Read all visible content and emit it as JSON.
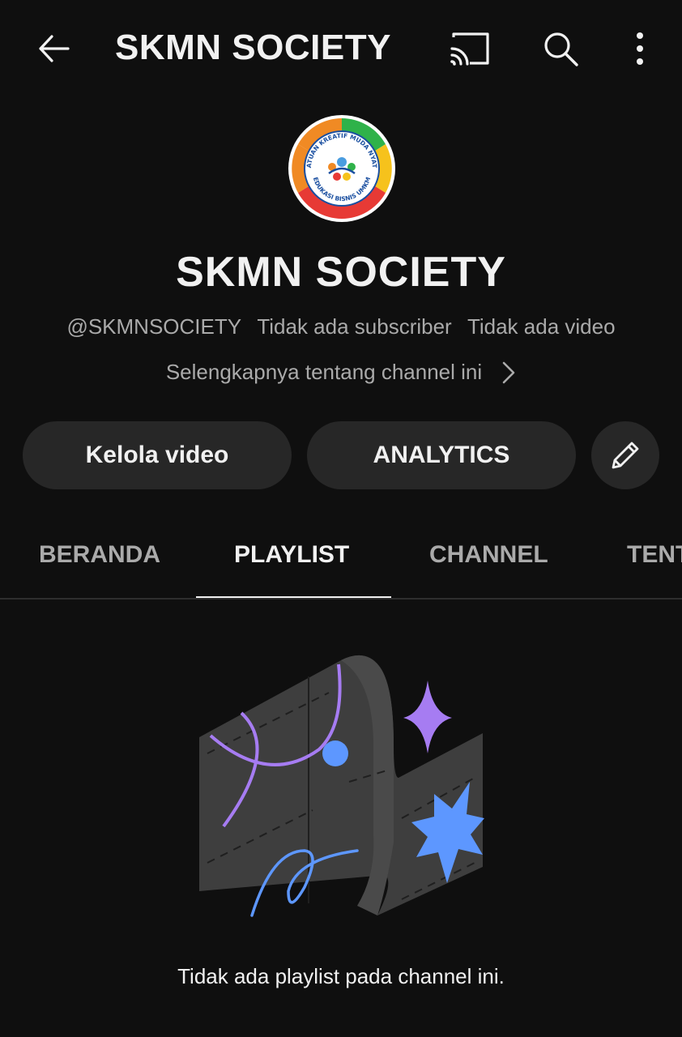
{
  "header": {
    "title": "SKMN SOCIETY",
    "back_icon": "arrow-back-icon",
    "cast_icon": "cast-icon",
    "search_icon": "search-icon",
    "more_icon": "more-vert-icon"
  },
  "channel": {
    "logo_text_top": "SATUAN KREATIF MUDA NYATA",
    "logo_text_bottom": "EDUKASI BISNIS UMKM",
    "name": "SKMN SOCIETY",
    "handle": "@SKMNSOCIETY",
    "subscribers": "Tidak ada subscriber",
    "videos": "Tidak ada video",
    "about_link": "Selengkapnya tentang channel ini"
  },
  "actions": {
    "manage_videos": "Kelola video",
    "analytics": "ANALYTICS",
    "edit_icon": "pencil-icon"
  },
  "tabs": [
    {
      "label": "BERANDA",
      "active": false
    },
    {
      "label": "PLAYLIST",
      "active": true
    },
    {
      "label": "CHANNEL",
      "active": false
    },
    {
      "label": "TENT",
      "active": false
    }
  ],
  "empty_state": {
    "message": "Tidak ada playlist pada channel ini.",
    "colors": {
      "purple": "#a67cf2",
      "blue": "#5d97ff",
      "panel": "#3e3e3e"
    }
  },
  "theme": {
    "background": "#0f0f0f",
    "pill_bg": "#272727",
    "text_primary": "#f1f1f1",
    "text_secondary": "#aaaaaa"
  }
}
